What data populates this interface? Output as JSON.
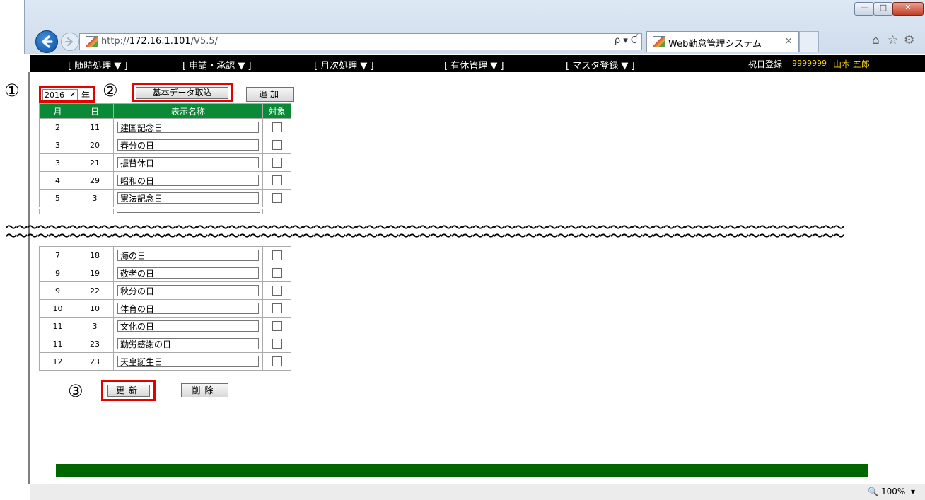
{
  "browser": {
    "url_prefix": "http://",
    "url_host": "172.16.1.101",
    "url_path": "/V5.5/",
    "address_tools": "ρ ▾ Ƈ",
    "tab_title": "Web勤怠管理システム",
    "tab_close": "×",
    "zoom_level": "100%",
    "zoom_caret": "▾"
  },
  "menu": {
    "items": [
      "[ 随時処理 ▼ ]",
      "[ 申請・承認 ▼ ]",
      "[ 月次処理 ▼ ]",
      "[ 有休管理 ▼ ]",
      "[ マスタ登録 ▼ ]"
    ],
    "page_name": "祝日登録",
    "user_id": "9999999",
    "user_name": "山本 五郎"
  },
  "annotations": {
    "mark1": "①",
    "mark2": "②",
    "mark3": "③"
  },
  "controls": {
    "year_value": "2016",
    "year_unit": "年",
    "import_button": "基本データ取込",
    "add_button": "追加",
    "update_button": "更新",
    "delete_button": "削除"
  },
  "table": {
    "headers": [
      "月",
      "日",
      "表示名称",
      "対象"
    ],
    "rows_top": [
      {
        "month": "2",
        "day": "11",
        "name": "建国記念日"
      },
      {
        "month": "3",
        "day": "20",
        "name": "春分の日"
      },
      {
        "month": "3",
        "day": "21",
        "name": "振替休日"
      },
      {
        "month": "4",
        "day": "29",
        "name": "昭和の日"
      },
      {
        "month": "5",
        "day": "3",
        "name": "憲法記念日"
      }
    ],
    "rows_bottom": [
      {
        "month": "7",
        "day": "18",
        "name": "海の日"
      },
      {
        "month": "9",
        "day": "19",
        "name": "敬老の日"
      },
      {
        "month": "9",
        "day": "22",
        "name": "秋分の日"
      },
      {
        "month": "10",
        "day": "10",
        "name": "体育の日"
      },
      {
        "month": "11",
        "day": "3",
        "name": "文化の日"
      },
      {
        "month": "11",
        "day": "23",
        "name": "勤労感謝の日"
      },
      {
        "month": "12",
        "day": "23",
        "name": "天皇誕生日"
      }
    ]
  },
  "cut_marker": "〜〜〜〜〜〜〜〜〜〜〜〜〜〜〜〜〜〜〜〜〜〜〜〜〜〜〜〜〜〜〜〜〜〜〜〜〜〜〜〜〜〜〜〜〜〜〜〜〜〜〜〜〜〜〜〜〜〜〜〜〜〜〜〜〜〜〜〜〜〜〜〜〜〜〜〜〜〜〜"
}
